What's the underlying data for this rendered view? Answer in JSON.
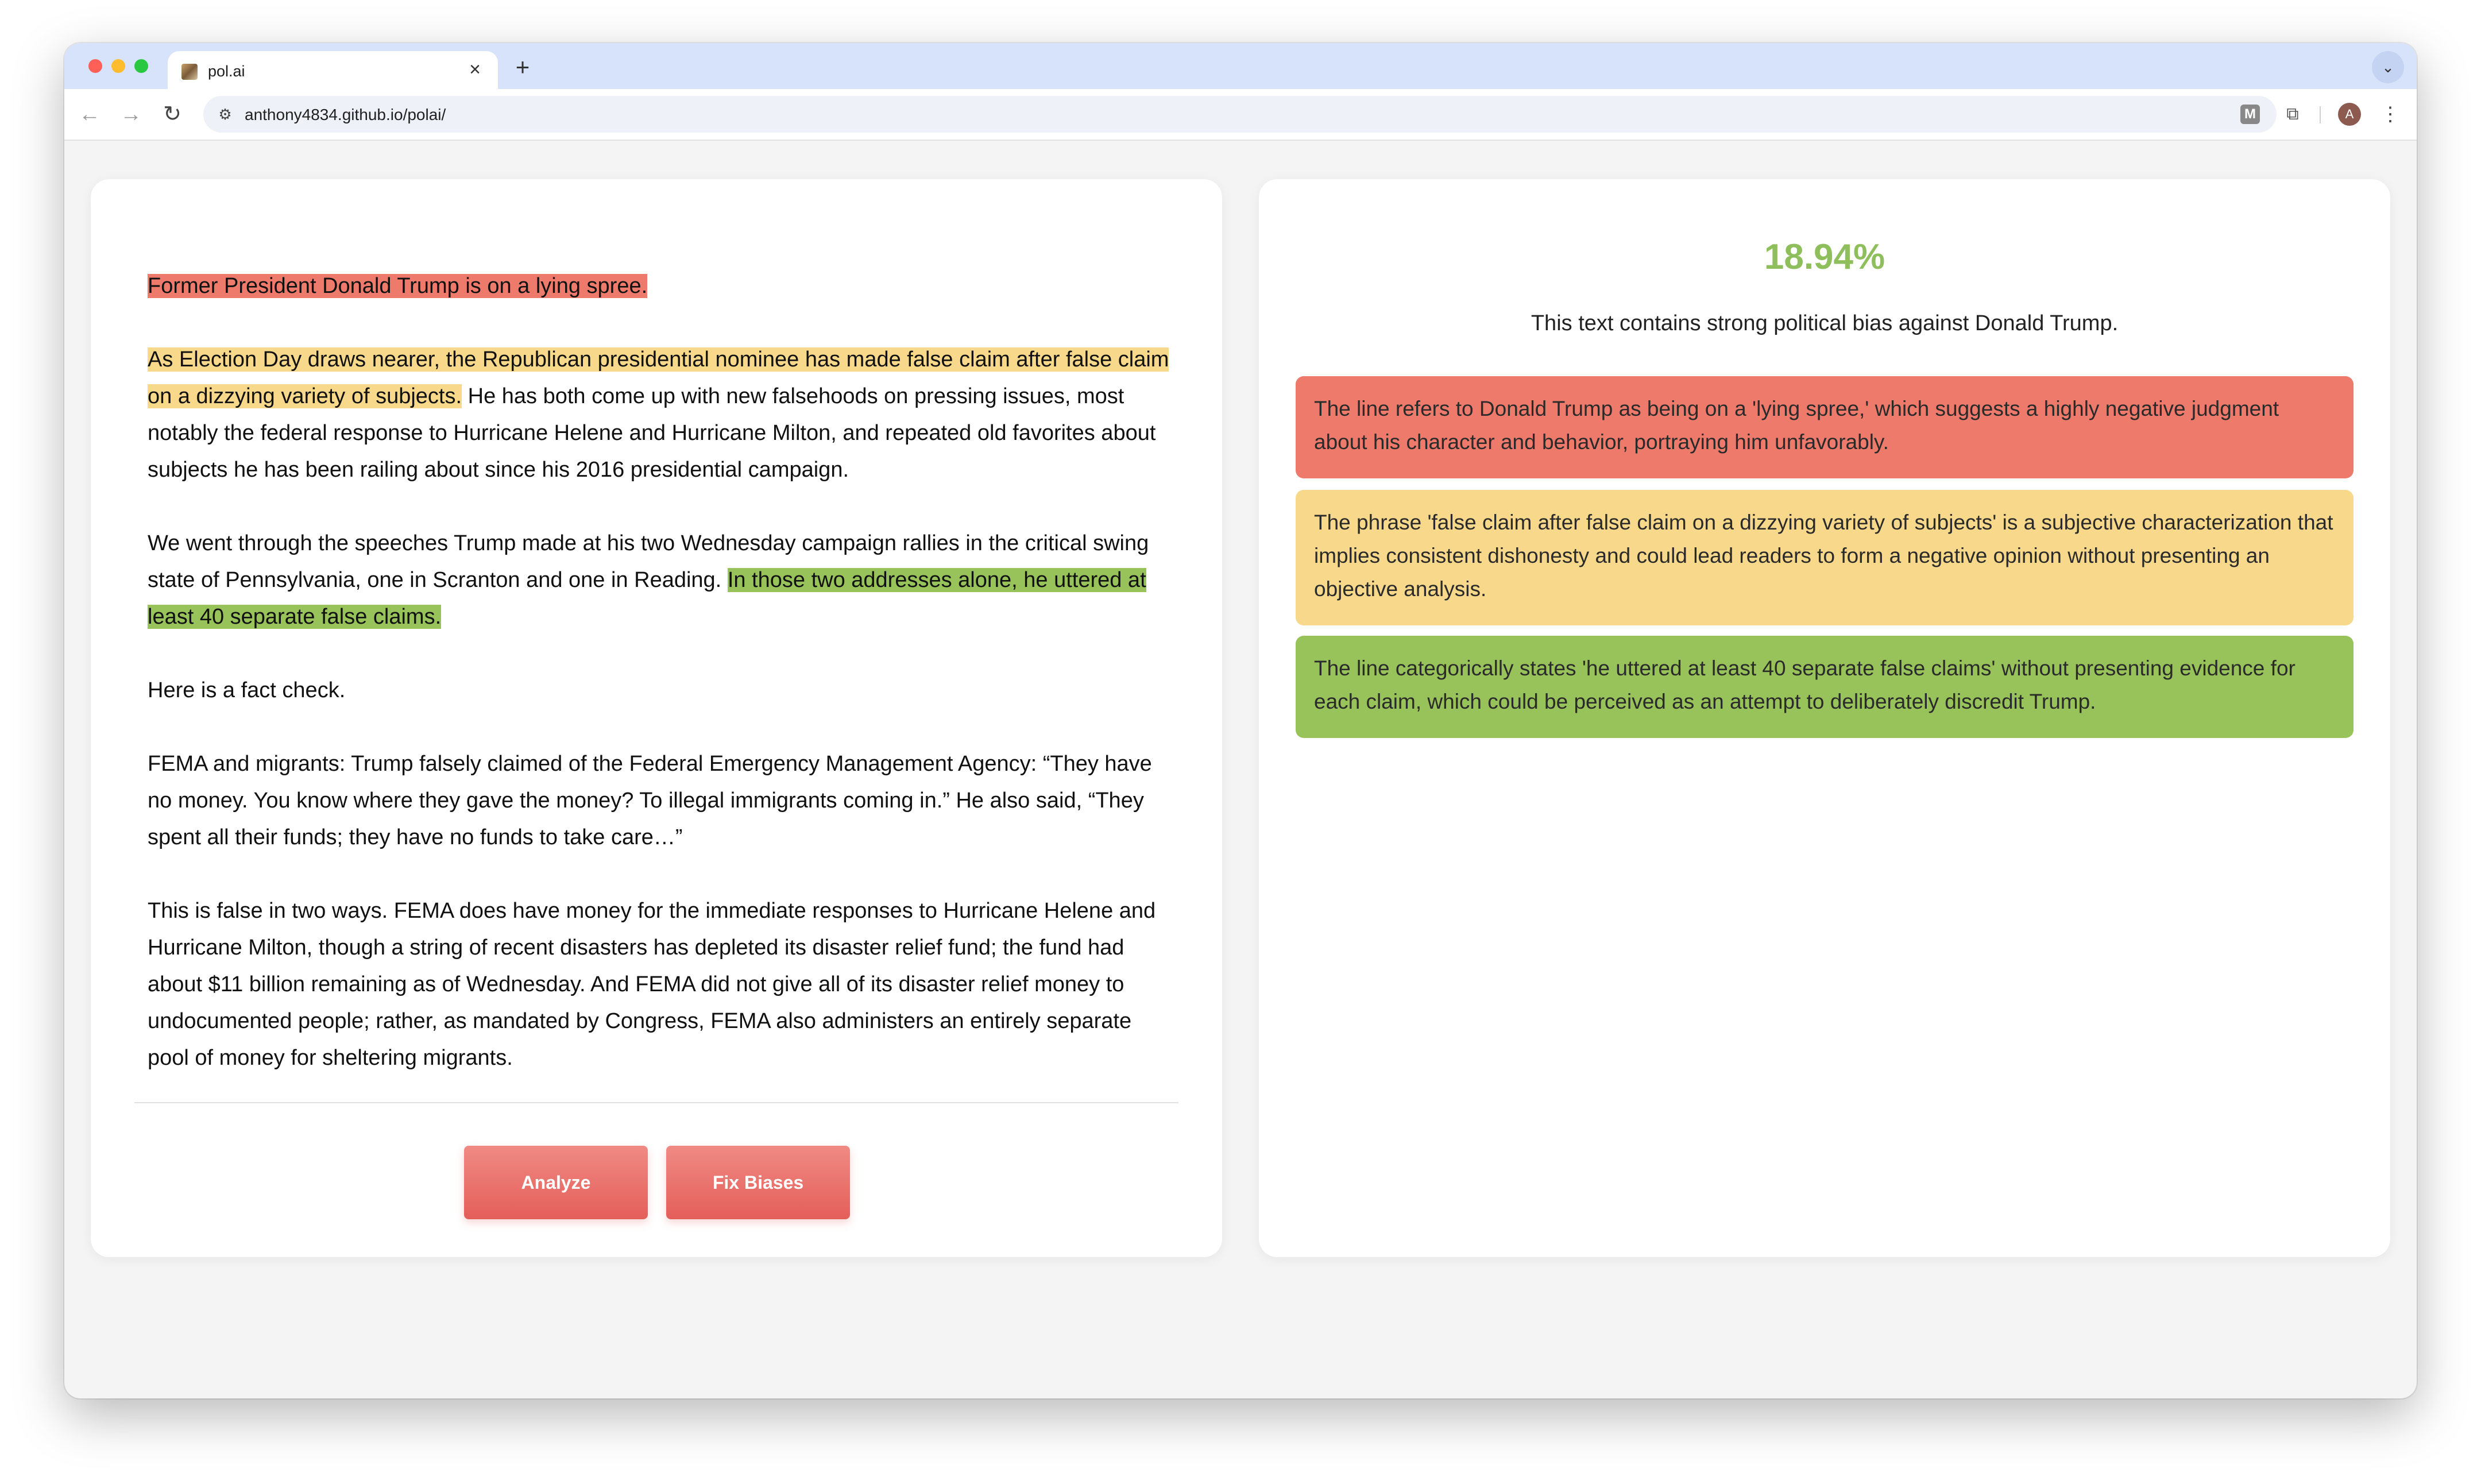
{
  "browser": {
    "tab_title": "pol.ai",
    "url": "anthony4834.github.io/polai/",
    "avatar_letter": "A",
    "extension_letter": "M"
  },
  "article": {
    "p1_hl": "Former President Donald Trump is on a lying spree.",
    "p2_hl": "As Election Day draws nearer, the Republican presidential nominee has made false claim after false claim on a dizzying variety of subjects.",
    "p2_rest": " He has both come up with new falsehoods on pressing issues, most notably the federal response to Hurricane Helene and Hurricane Milton, and repeated old favorites about subjects he has been railing about since his 2016 presidential campaign.",
    "p3_plain": "We went through the speeches Trump made at his two Wednesday campaign rallies in the critical swing state of Pennsylvania, one in Scranton and one in Reading. ",
    "p3_hl": "In those two addresses alone, he uttered at least 40 separate false claims.",
    "p4": "Here is a fact check.",
    "p5": "FEMA and migrants: Trump falsely claimed of the Federal Emergency Management Agency: “They have no money. You know where they gave the money? To illegal immigrants coming in.” He also said, “They spent all their funds; they have no funds to take care…”",
    "p6": "This is false in two ways. FEMA does have money for the immediate responses to Hurricane Helene and Hurricane Milton, though a string of recent disasters has depleted its disaster relief fund; the fund had about $11 billion remaining as of Wednesday. And FEMA did not give all of its disaster relief money to undocumented people; rather, as mandated by Congress, FEMA also administers an entirely separate pool of money for sheltering migrants."
  },
  "buttons": {
    "analyze": "Analyze",
    "fix": "Fix Biases"
  },
  "result": {
    "score": "18.94%",
    "summary": "This text contains strong political bias against Donald Trump.",
    "issues": [
      "The line refers to Donald Trump as being on a 'lying spree,' which suggests a highly negative judgment about his character and behavior, portraying him unfavorably.",
      "The phrase 'false claim after false claim on a dizzying variety of subjects' is a subjective characterization that implies consistent dishonesty and could lead readers to form a negative opinion without presenting an objective analysis.",
      "The line categorically states 'he uttered at least 40 separate false claims' without presenting evidence for each claim, which could be perceived as an attempt to deliberately discredit Trump."
    ]
  },
  "colors": {
    "highlight_red": "#ee7a6c",
    "highlight_yellow": "#f8d98b",
    "highlight_green": "#98c25a",
    "score_green": "#8fbf5c",
    "button_red": "#e45e59"
  },
  "icons": [
    "close-icon",
    "plus-icon",
    "chevron-down-icon",
    "back-arrow-icon",
    "forward-arrow-icon",
    "reload-icon",
    "site-settings-icon",
    "star-icon",
    "puzzle-icon",
    "kebab-menu-icon"
  ]
}
